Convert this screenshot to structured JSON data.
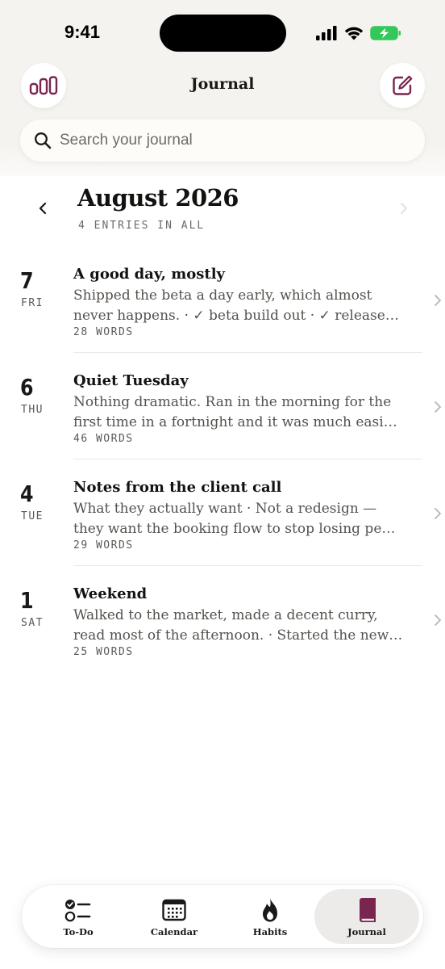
{
  "status_bar": {
    "time": "9:41"
  },
  "header": {
    "title": "Journal",
    "search_placeholder": "Search your journal"
  },
  "month": {
    "title": "August 2026",
    "count": "4 ENTRIES IN ALL"
  },
  "entries": [
    {
      "day_num": "7",
      "day_name": "FRI",
      "title": "A good day, mostly",
      "line1": "Shipped the beta a day early, which almost",
      "line2": "never happens. · ✓ beta build out · ✓ release…",
      "words": "28 WORDS"
    },
    {
      "day_num": "6",
      "day_name": "THU",
      "title": "Quiet Tuesday",
      "line1": "Nothing dramatic. Ran in the morning for the",
      "line2": "first time in a fortnight and it was much easi…",
      "words": "46 WORDS"
    },
    {
      "day_num": "4",
      "day_name": "TUE",
      "title": "Notes from the client call",
      "line1": "What they actually want · Not a redesign —",
      "line2": "they want the booking flow to stop losing pe…",
      "words": "29 WORDS"
    },
    {
      "day_num": "1",
      "day_name": "SAT",
      "title": "Weekend",
      "line1": "Walked to the market, made a decent curry,",
      "line2": "read most of the afternoon. · Started the new…",
      "words": "25 WORDS"
    }
  ],
  "tabs": [
    {
      "label": "To-Do",
      "icon": "checklist-icon",
      "active": false
    },
    {
      "label": "Calendar",
      "icon": "calendar-icon",
      "active": false
    },
    {
      "label": "Habits",
      "icon": "flame-icon",
      "active": false
    },
    {
      "label": "Journal",
      "icon": "book-icon",
      "active": true
    }
  ],
  "colors": {
    "accent": "#7a2450",
    "background_top": "#f5f3ef",
    "text": "#1b1917",
    "muted": "#55514d",
    "battery": "#34c759"
  }
}
